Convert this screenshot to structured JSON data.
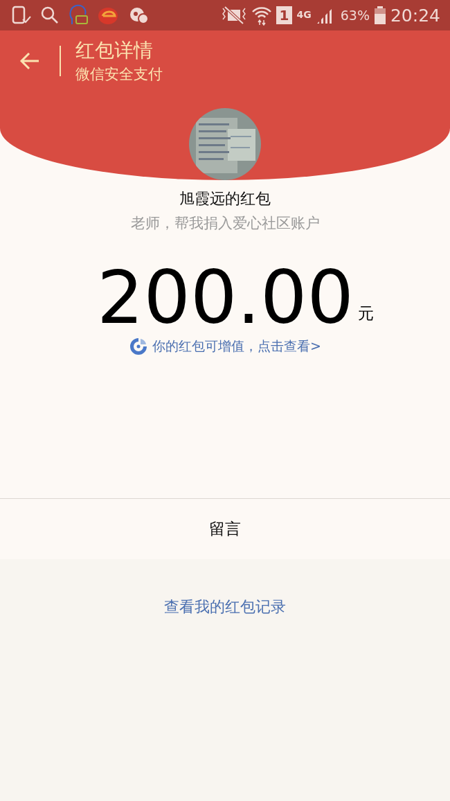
{
  "status_bar": {
    "sim_slot": "1",
    "network": "4G",
    "battery": "63%",
    "time": "20:24"
  },
  "header": {
    "title": "红包详情",
    "subtitle": "微信安全支付"
  },
  "packet": {
    "sender": "旭霞远的红包",
    "message": "老师，帮我捐入爱心社区账户",
    "amount": "200.00",
    "currency": "元",
    "promo_link": "你的红包可增值，点击查看>"
  },
  "comment_row": {
    "label": "留言"
  },
  "records_link": "查看我的红包记录"
}
